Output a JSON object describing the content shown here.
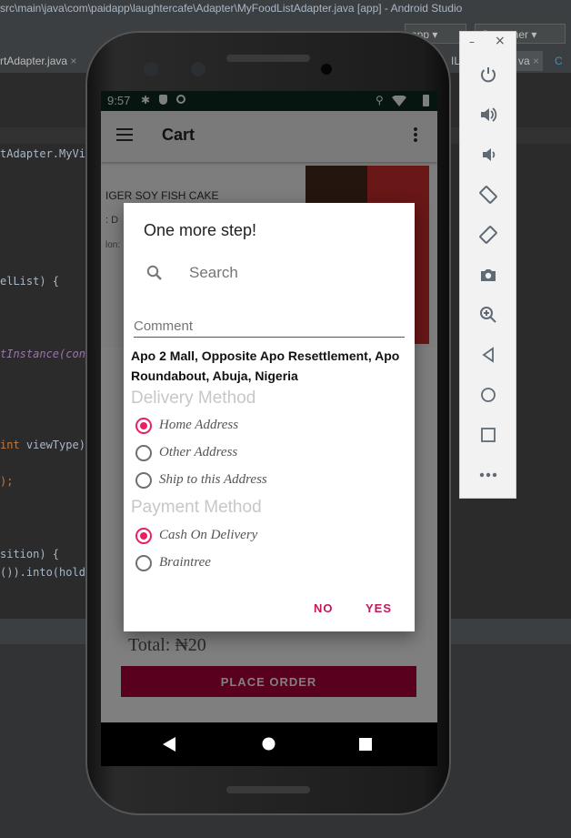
{
  "ide": {
    "title": "src\\main\\java\\com\\paidapp\\laughtercafe\\Adapter\\MyFoodListAdapter.java [app] - Android Studio",
    "module_selector": "app",
    "run_config": "Customer",
    "tabs": [
      "rtAdapter.java",
      "IL",
      "va"
    ],
    "code_lines": [
      "tAdapter.MyVie",
      "elList) {",
      "tInstance(cont",
      "int viewType)",
      ");",
      "sition) {",
      "()).into(holde"
    ]
  },
  "emulator": {
    "window_controls": {
      "minimize": "–",
      "close": "×"
    },
    "controls": [
      "power-icon",
      "volume-up-icon",
      "volume-down-icon",
      "rotate-left-icon",
      "rotate-right-icon",
      "camera-icon",
      "zoom-icon",
      "back-icon",
      "home-icon",
      "overview-icon",
      "more-icon"
    ]
  },
  "status_bar": {
    "time": "9:57"
  },
  "app_bar": {
    "title": "Cart"
  },
  "cart_item": {
    "name": "IGER SOY FISH CAKE",
    "meta1": ": D",
    "meta2": "lon:"
  },
  "footer": {
    "total": "Total: ₦20",
    "place_order": "PLACE ORDER"
  },
  "dialog": {
    "title": "One more step!",
    "search_placeholder": "Search",
    "comment_placeholder": "Comment",
    "address": "Apo 2 Mall, Opposite Apo Resettlement, Apo Roundabout, Abuja, Nigeria",
    "delivery_heading": "Delivery Method",
    "delivery_options": [
      {
        "label": "Home Address",
        "selected": true
      },
      {
        "label": "Other Address",
        "selected": false
      },
      {
        "label": "Ship to this Address",
        "selected": false
      }
    ],
    "payment_heading": "Payment Method",
    "payment_options": [
      {
        "label": "Cash On Delivery",
        "selected": true
      },
      {
        "label": "Braintree",
        "selected": false
      }
    ],
    "no_label": "NO",
    "yes_label": "YES"
  },
  "colors": {
    "accent": "#e91e63",
    "button": "#c2185b",
    "place_order_bg": "#8b0030",
    "status_bar": "#0c2b20"
  }
}
